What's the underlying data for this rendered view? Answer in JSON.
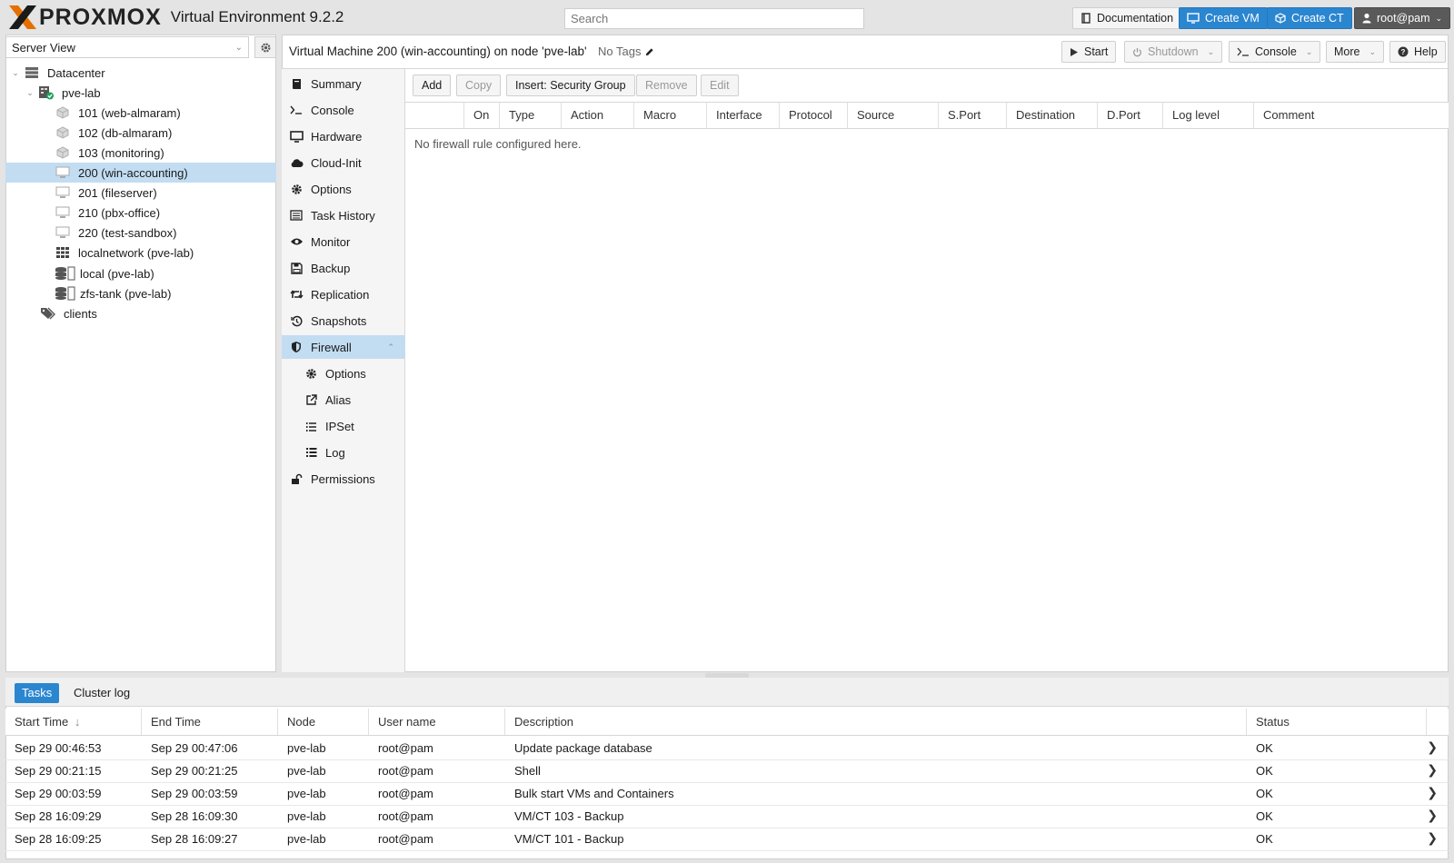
{
  "header": {
    "brand": "PROXMOX",
    "product": "Virtual Environment 9.2.2",
    "search_placeholder": "Search",
    "documentation": "Documentation",
    "create_vm": "Create VM",
    "create_ct": "Create CT",
    "user": "root@pam"
  },
  "tree": {
    "view": "Server View",
    "items": [
      {
        "label": "Datacenter",
        "icon": "datacenter-icon"
      },
      {
        "label": "pve-lab",
        "icon": "node-online-icon"
      },
      {
        "label": "101 (web-almaram)",
        "icon": "container-icon"
      },
      {
        "label": "102 (db-almaram)",
        "icon": "container-icon"
      },
      {
        "label": "103 (monitoring)",
        "icon": "container-icon"
      },
      {
        "label": "200 (win-accounting)",
        "icon": "vm-icon"
      },
      {
        "label": "201 (fileserver)",
        "icon": "vm-icon"
      },
      {
        "label": "210 (pbx-office)",
        "icon": "vm-icon"
      },
      {
        "label": "220 (test-sandbox)",
        "icon": "vm-icon"
      },
      {
        "label": "localnetwork (pve-lab)",
        "icon": "sdn-grid-icon"
      },
      {
        "label": "local (pve-lab)",
        "icon": "storage-icon"
      },
      {
        "label": "zfs-tank (pve-lab)",
        "icon": "storage-icon"
      },
      {
        "label": "clients",
        "icon": "tags-icon"
      }
    ]
  },
  "content": {
    "title": "Virtual Machine 200 (win-accounting) on node 'pve-lab'",
    "tags": "No Tags",
    "toolbar": {
      "start": "Start",
      "shutdown": "Shutdown",
      "console": "Console",
      "more": "More",
      "help": "Help"
    }
  },
  "nav": [
    {
      "label": "Summary",
      "icon": "book-icon"
    },
    {
      "label": "Console",
      "icon": "terminal-icon"
    },
    {
      "label": "Hardware",
      "icon": "desktop-icon"
    },
    {
      "label": "Cloud-Init",
      "icon": "cloud-icon"
    },
    {
      "label": "Options",
      "icon": "gear-icon"
    },
    {
      "label": "Task History",
      "icon": "list-alt-icon"
    },
    {
      "label": "Monitor",
      "icon": "eye-icon"
    },
    {
      "label": "Backup",
      "icon": "floppy-icon"
    },
    {
      "label": "Replication",
      "icon": "retweet-icon"
    },
    {
      "label": "Snapshots",
      "icon": "history-icon"
    },
    {
      "label": "Firewall",
      "icon": "shield-icon"
    },
    {
      "label": "Options",
      "icon": "gear-icon"
    },
    {
      "label": "Alias",
      "icon": "external-link-icon"
    },
    {
      "label": "IPSet",
      "icon": "list-ol-icon"
    },
    {
      "label": "Log",
      "icon": "list-icon"
    },
    {
      "label": "Permissions",
      "icon": "unlock-icon"
    }
  ],
  "firewall": {
    "buttons": {
      "add": "Add",
      "copy": "Copy",
      "insert": "Insert: Security Group",
      "remove": "Remove",
      "edit": "Edit"
    },
    "columns": [
      "On",
      "Type",
      "Action",
      "Macro",
      "Interface",
      "Protocol",
      "Source",
      "S.Port",
      "Destination",
      "D.Port",
      "Log level",
      "Comment"
    ],
    "empty": "No firewall rule configured here."
  },
  "tasks": {
    "tabs": [
      "Tasks",
      "Cluster log"
    ],
    "columns": [
      "Start Time",
      "End Time",
      "Node",
      "User name",
      "Description",
      "Status"
    ],
    "sort_indicator": "↓",
    "rows": [
      {
        "start": "Sep 29 00:46:53",
        "end": "Sep 29 00:47:06",
        "node": "pve-lab",
        "user": "root@pam",
        "desc": "Update package database",
        "status": "OK"
      },
      {
        "start": "Sep 29 00:21:15",
        "end": "Sep 29 00:21:25",
        "node": "pve-lab",
        "user": "root@pam",
        "desc": "Shell",
        "status": "OK"
      },
      {
        "start": "Sep 29 00:03:59",
        "end": "Sep 29 00:03:59",
        "node": "pve-lab",
        "user": "root@pam",
        "desc": "Bulk start VMs and Containers",
        "status": "OK"
      },
      {
        "start": "Sep 28 16:09:29",
        "end": "Sep 28 16:09:30",
        "node": "pve-lab",
        "user": "root@pam",
        "desc": "VM/CT 103 - Backup",
        "status": "OK"
      },
      {
        "start": "Sep 28 16:09:25",
        "end": "Sep 28 16:09:27",
        "node": "pve-lab",
        "user": "root@pam",
        "desc": "VM/CT 101 - Backup",
        "status": "OK"
      }
    ]
  },
  "colors": {
    "accent": "#2b86d0",
    "selection": "#c2ddf2",
    "brand_orange": "#e57000"
  }
}
